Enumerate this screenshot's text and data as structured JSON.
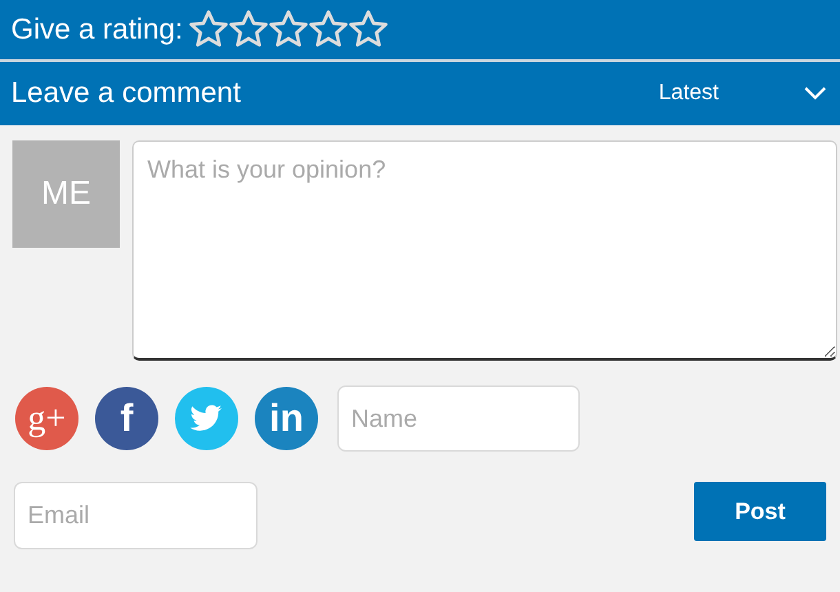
{
  "rating": {
    "label": "Give a rating:",
    "stars": 0
  },
  "comments_header": {
    "title": "Leave a comment",
    "sort": "Latest"
  },
  "avatar": {
    "text": "ME"
  },
  "comment_field": {
    "placeholder": "What is your opinion?"
  },
  "social": [
    {
      "kind": "google",
      "glyph": "g+"
    },
    {
      "kind": "facebook",
      "glyph": "f"
    },
    {
      "kind": "twitter"
    },
    {
      "kind": "linkedin",
      "glyph": "in"
    }
  ],
  "name_field": {
    "placeholder": "Name"
  },
  "email_field": {
    "placeholder": "Email"
  },
  "post_button": {
    "label": "Post"
  }
}
